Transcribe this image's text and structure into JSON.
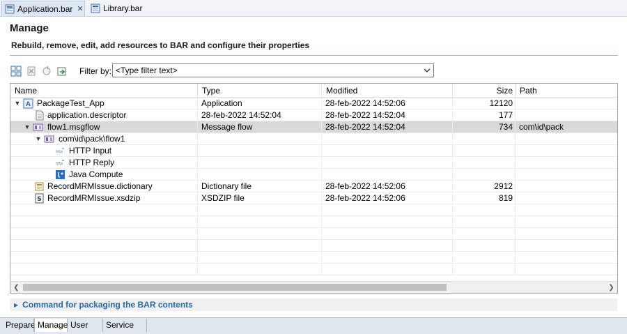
{
  "tabs": [
    {
      "label": "Application.bar",
      "close": "✕"
    },
    {
      "label": "Library.bar"
    }
  ],
  "header": {
    "title": "Manage",
    "subtitle": "Rebuild, remove, edit, add resources to BAR and configure their properties"
  },
  "toolbar": {
    "filter_label": "Filter by:",
    "filter_value": "<Type filter text>"
  },
  "table": {
    "columns": [
      "Name",
      "Type",
      "Modified",
      "Size",
      "Path"
    ],
    "rows": [
      {
        "name": "PackageTest_App",
        "type": "Application",
        "modified": "28-feb-2022  14:52:06",
        "size": "12120",
        "path": ""
      },
      {
        "name": "application.descriptor",
        "type": "28-feb-2022 14:52:04",
        "modified": "28-feb-2022  14:52:04",
        "size": "177",
        "path": ""
      },
      {
        "name": "flow1.msgflow",
        "type": "Message flow",
        "modified": "28-feb-2022  14:52:04",
        "size": "734",
        "path": "com\\id\\pack"
      },
      {
        "name": "com\\id\\pack\\flow1",
        "type": "",
        "modified": "",
        "size": "",
        "path": ""
      },
      {
        "name": "HTTP Input",
        "type": "",
        "modified": "",
        "size": "",
        "path": ""
      },
      {
        "name": "HTTP Reply",
        "type": "",
        "modified": "",
        "size": "",
        "path": ""
      },
      {
        "name": "Java Compute",
        "type": "",
        "modified": "",
        "size": "",
        "path": ""
      },
      {
        "name": "RecordMRMIssue.dictionary",
        "type": "Dictionary file",
        "modified": "28-feb-2022  14:52:06",
        "size": "2912",
        "path": ""
      },
      {
        "name": "RecordMRMIssue.xsdzip",
        "type": "XSDZIP file",
        "modified": "28-feb-2022  14:52:06",
        "size": "819",
        "path": ""
      }
    ]
  },
  "command": {
    "label": "Command for packaging the BAR contents"
  },
  "bottom_tabs": [
    "Prepare",
    "Manage",
    "User Log",
    "Service Log"
  ],
  "colors": {
    "accent": "#2169b0",
    "selection": "#d9d9d9",
    "tab_active": "#dde8f6"
  }
}
